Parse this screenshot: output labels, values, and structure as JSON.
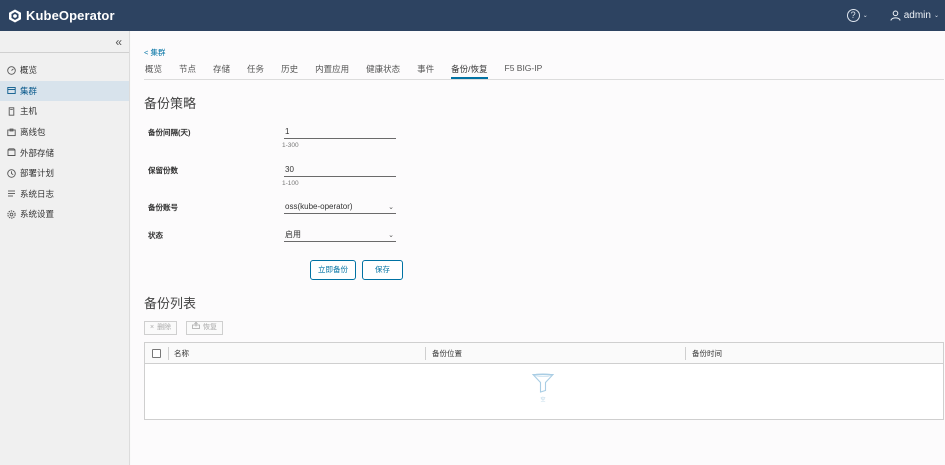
{
  "app": {
    "name": "KubeOperator"
  },
  "header": {
    "help_caret": "⌄",
    "user": "admin",
    "user_caret": "⌄"
  },
  "sidebar": {
    "collapse": "«",
    "items": [
      {
        "label": "概览",
        "icon": "dashboard-icon",
        "active": false
      },
      {
        "label": "集群",
        "icon": "cluster-icon",
        "active": true
      },
      {
        "label": "主机",
        "icon": "host-icon",
        "active": false
      },
      {
        "label": "离线包",
        "icon": "package-icon",
        "active": false
      },
      {
        "label": "外部存储",
        "icon": "storage-icon",
        "active": false
      },
      {
        "label": "部署计划",
        "icon": "plan-icon",
        "active": false
      },
      {
        "label": "系统日志",
        "icon": "log-icon",
        "active": false
      },
      {
        "label": "系统设置",
        "icon": "settings-icon",
        "active": false
      }
    ]
  },
  "breadcrumb": {
    "back": "< 集群"
  },
  "tabs": [
    "概览",
    "节点",
    "存储",
    "任务",
    "历史",
    "内置应用",
    "健康状态",
    "事件",
    "备份/恢复",
    "F5 BIG-IP"
  ],
  "active_tab": "备份/恢复",
  "policy": {
    "title": "备份策略",
    "interval": {
      "label": "备份间隔(天)",
      "value": "1",
      "help": "1-300"
    },
    "retain": {
      "label": "保留份数",
      "value": "30",
      "help": "1-100"
    },
    "account": {
      "label": "备份账号",
      "value": "oss(kube-operator)"
    },
    "status": {
      "label": "状态",
      "value": "启用"
    },
    "backup_now": "立即备份",
    "save": "保存"
  },
  "backup_list": {
    "title": "备份列表",
    "delete": "删除",
    "restore": "恢复",
    "columns": [
      "名称",
      "备份位置",
      "备份时间"
    ],
    "empty_text": "空"
  },
  "colors": {
    "header": "#2d4361",
    "accent": "#0072a3",
    "sidebar_active": "#d8e3ec"
  }
}
